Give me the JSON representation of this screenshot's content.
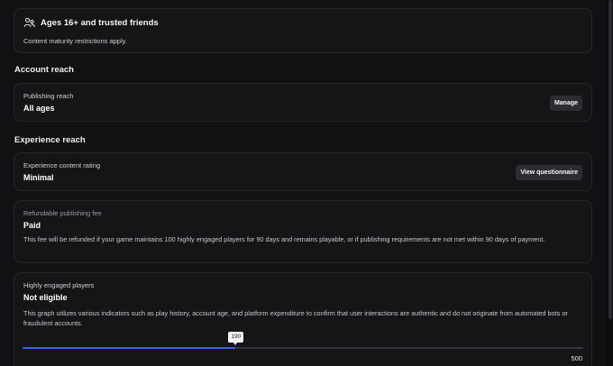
{
  "audience": {
    "title": "Ages 16+ and trusted friends",
    "description": "Content maturity restrictions apply.",
    "icon": "people-icon"
  },
  "account_reach": {
    "section_title": "Account reach",
    "label": "Publishing reach",
    "value": "All ages",
    "button": "Manage"
  },
  "experience_reach": {
    "section_title": "Experience reach",
    "rating": {
      "label": "Experience content rating",
      "value": "Minimal",
      "button": "View questionnaire"
    },
    "fee": {
      "label": "Refundable publishing fee",
      "value": "Paid",
      "description": "This fee will be refunded if your game maintains 100 highly engaged players for 90 days and remains playable, or if publishing requirements are not met within 90 days of payment."
    },
    "engaged": {
      "label": "Highly engaged players",
      "value": "Not eligible",
      "description": "This graph utilizes various indicators such as play history, account age, and platform expenditure to confirm that user interactions are authentic and do not originate from automated bots or fraudulent accounts.",
      "current": 190,
      "current_label": "190",
      "max": 500,
      "max_label": "500",
      "fill_color": "#3d63e8"
    }
  }
}
